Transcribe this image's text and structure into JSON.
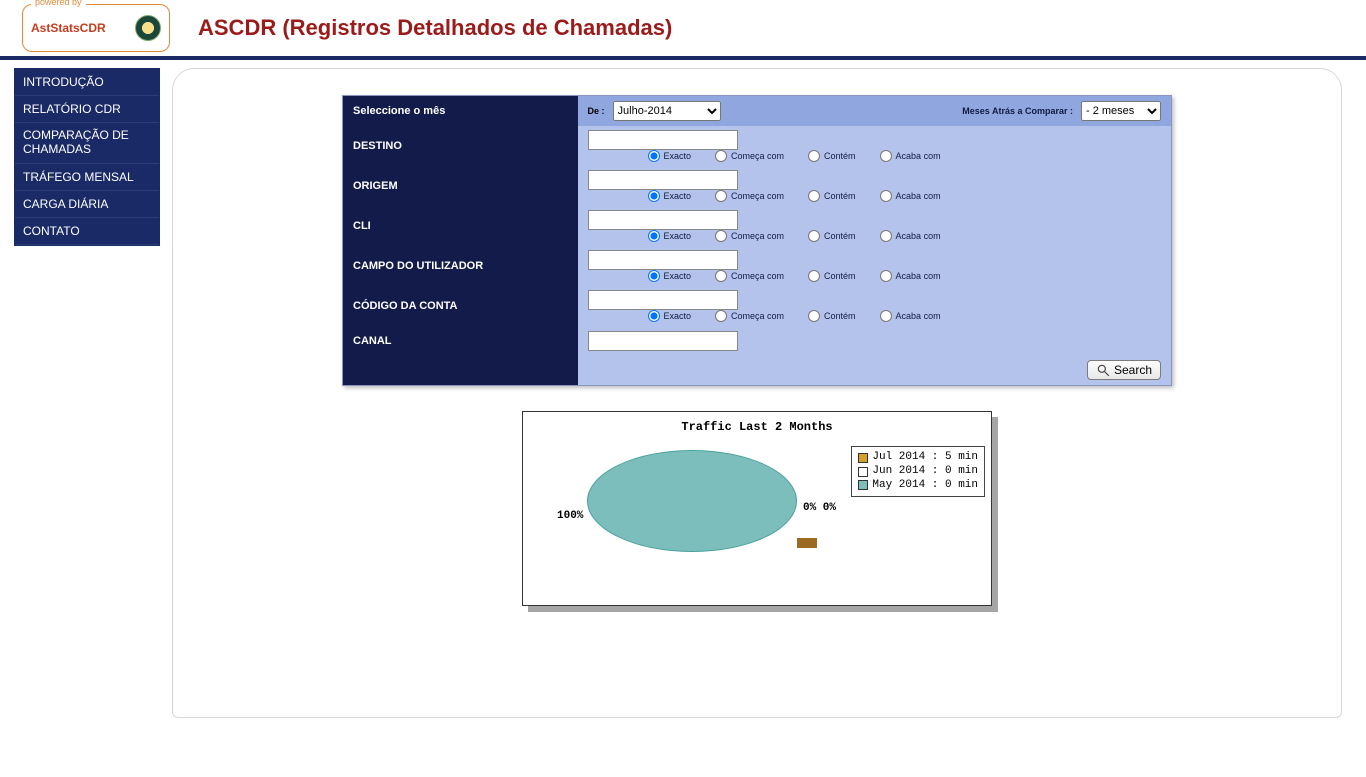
{
  "header": {
    "powered_by": "powered by",
    "brand": "AstStatsCDR",
    "title": "ASCDR (Registros Detalhados de Chamadas)"
  },
  "sidebar": {
    "items": [
      "INTRODUÇÃO",
      "RELATÓRIO CDR",
      "COMPARAÇÃO DE CHAMADAS",
      "TRÁFEGO MENSAL",
      "CARGA DIÁRIA",
      "CONTATO"
    ]
  },
  "filter": {
    "select_month_label": "Seleccione o mês",
    "de_label": "De :",
    "month_value": "Julho-2014",
    "months_back_label": "Meses Atrás a Comparar :",
    "months_back_value": "- 2 meses",
    "rows": [
      {
        "label": "DESTINO"
      },
      {
        "label": "ORIGEM"
      },
      {
        "label": "CLI"
      },
      {
        "label": "CAMPO DO UTILIZADOR"
      },
      {
        "label": "CÓDIGO DA CONTA"
      },
      {
        "label": "CANAL"
      }
    ],
    "radio_labels": {
      "exact": "Exacto",
      "begins": "Começa com",
      "contains": "Contém",
      "ends": "Acaba com"
    },
    "search_label": "Search"
  },
  "chart_data": {
    "type": "pie",
    "title": "Traffic Last 2 Months",
    "series": [
      {
        "name": "Jul 2014 : 5 min",
        "value": 5,
        "percent_label": "0%"
      },
      {
        "name": "Jun 2014 : 0 min",
        "value": 0,
        "percent_label": "0%"
      },
      {
        "name": "May 2014 : 0 min",
        "value": 0,
        "percent_label": "100%"
      }
    ],
    "annotations": {
      "left": "100%",
      "right": "0% 0%"
    }
  }
}
